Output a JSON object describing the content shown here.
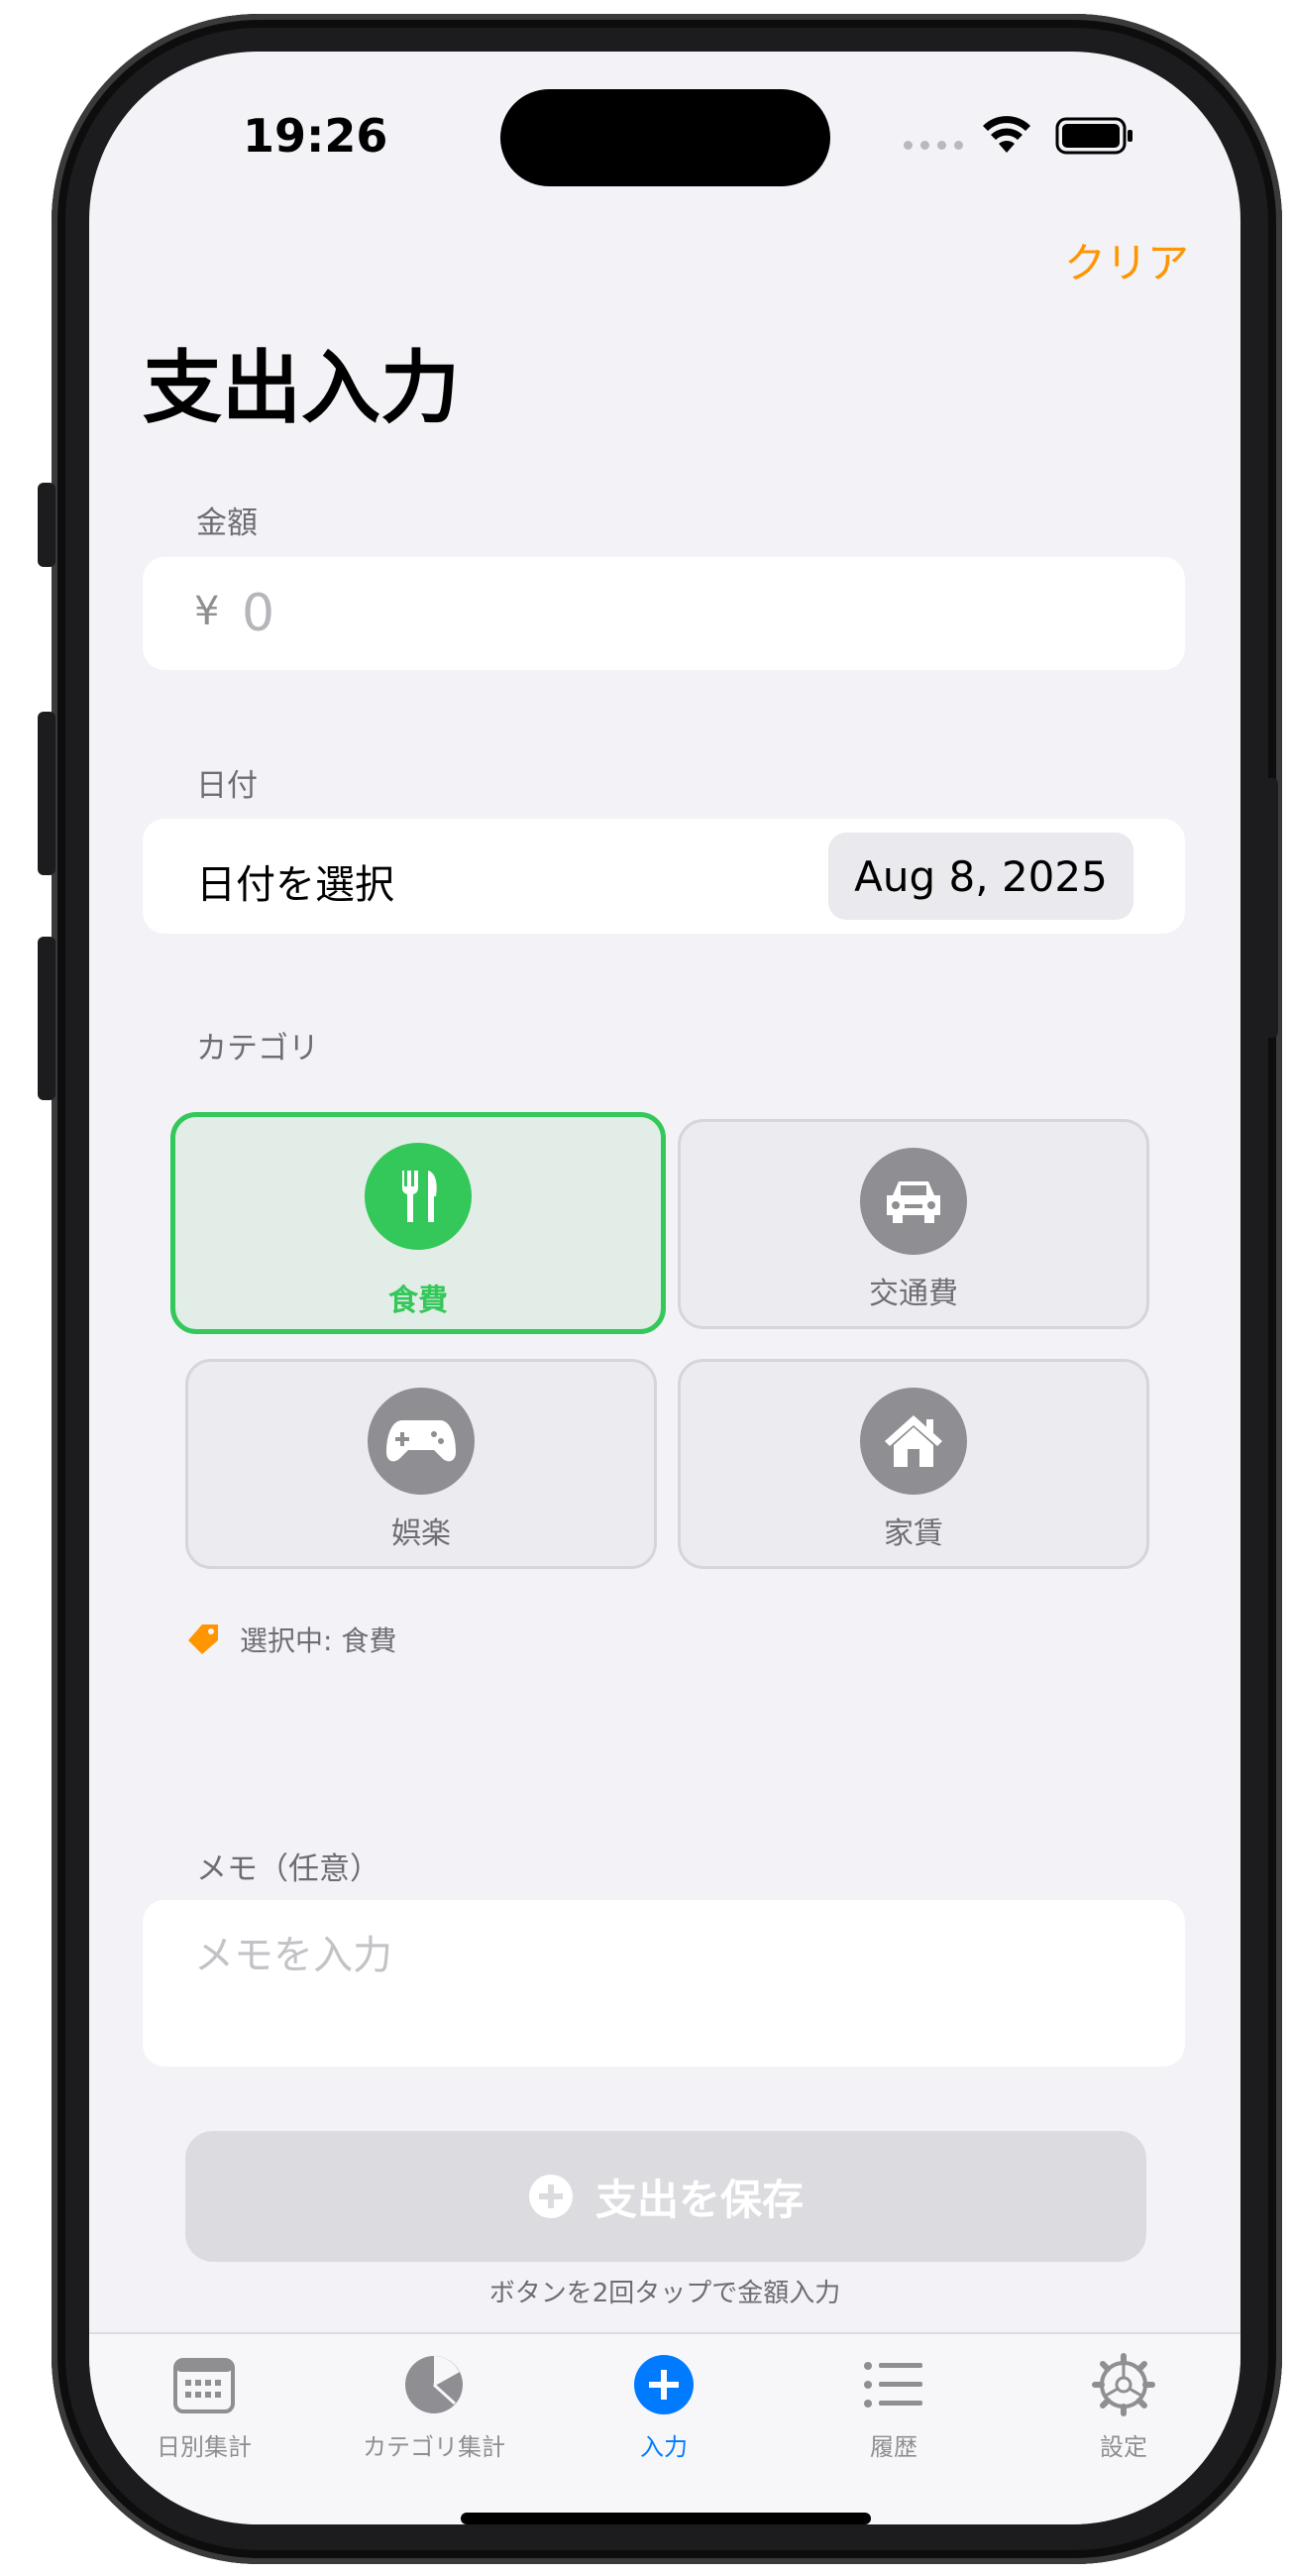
{
  "status_bar": {
    "time": "19:26"
  },
  "header": {
    "clear_label": "クリア",
    "title": "支出入力"
  },
  "amount": {
    "label": "金額",
    "currency": "¥",
    "placeholder": "0"
  },
  "date": {
    "section_label": "日付",
    "row_label": "日付を選択",
    "value": "Aug 8, 2025"
  },
  "category": {
    "label": "カテゴリ",
    "items": [
      {
        "label": "食費",
        "icon": "fork-knife-icon",
        "selected": true
      },
      {
        "label": "交通費",
        "icon": "car-icon",
        "selected": false
      },
      {
        "label": "娯楽",
        "icon": "game-controller-icon",
        "selected": false
      },
      {
        "label": "家賃",
        "icon": "house-icon",
        "selected": false
      }
    ],
    "selected_text": "選択中: 食費"
  },
  "memo": {
    "label": "メモ（任意）",
    "placeholder": "メモを入力"
  },
  "save": {
    "label": "支出を保存",
    "hint": "ボタンを2回タップで金額入力"
  },
  "tabs": [
    {
      "label": "日別集計",
      "icon": "calendar-icon",
      "active": false
    },
    {
      "label": "カテゴリ集計",
      "icon": "pie-chart-icon",
      "active": false
    },
    {
      "label": "入力",
      "icon": "plus-circle-icon",
      "active": true
    },
    {
      "label": "履歴",
      "icon": "list-icon",
      "active": false
    },
    {
      "label": "設定",
      "icon": "gear-icon",
      "active": false
    }
  ],
  "colors": {
    "accent": "#ff9500",
    "selected": "#34c759",
    "tab_active": "#007aff"
  }
}
